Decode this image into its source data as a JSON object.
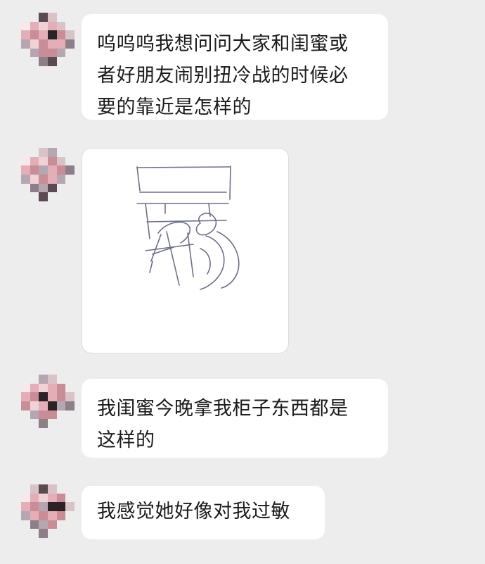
{
  "messages": [
    {
      "type": "text",
      "lines": [
        "呜呜呜我想问问大家和闺蜜或",
        "者好朋友闹别扭冷战的时候必",
        "要的靠近是怎样的"
      ]
    },
    {
      "type": "image",
      "image": "hand-drawn-sketch"
    },
    {
      "type": "text",
      "lines": [
        "我闺蜜今晚拿我柜子东西都是",
        "这样的"
      ]
    },
    {
      "type": "text",
      "lines": [
        "我感觉她好像对我过敏"
      ]
    }
  ],
  "avatar": {
    "style": "pixelated-mosaic",
    "colors": [
      "#f0d2d6",
      "#e3aeb7",
      "#c98d98",
      "#b5a6b0",
      "#8c7f88",
      "#5a4a52",
      "#2c2226",
      "#f7e9eb",
      "#d9c3c9"
    ]
  },
  "colors": {
    "background": "#ededed",
    "bubble": "#ffffff",
    "text": "#1a1a1a",
    "sketch_ink": "#6d6f8a"
  }
}
